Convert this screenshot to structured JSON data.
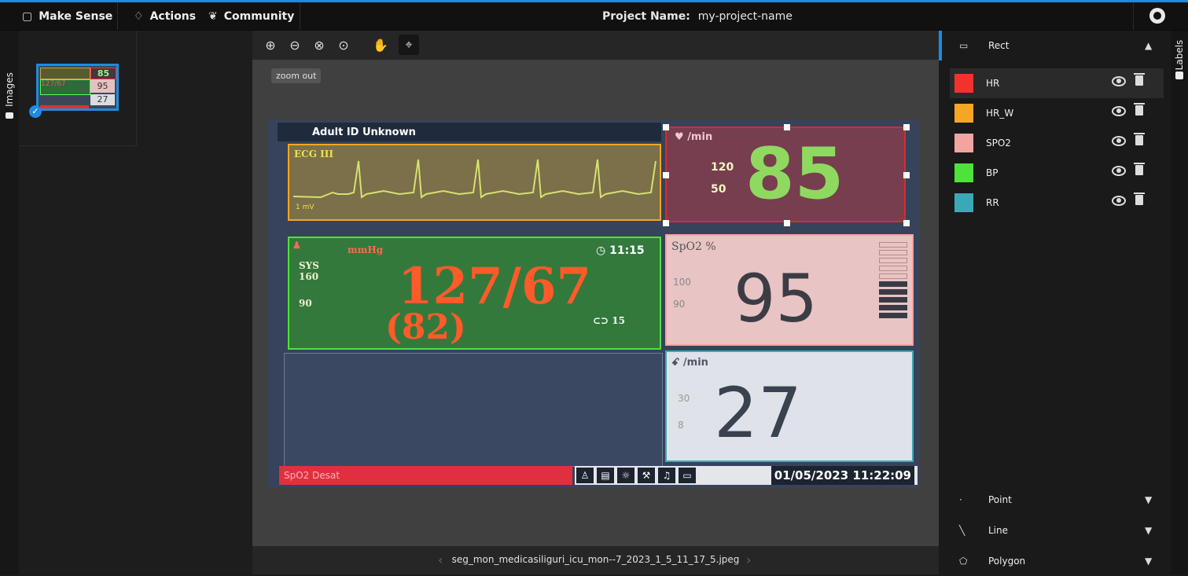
{
  "topbar": {
    "app_title": "Make Sense",
    "actions_label": "Actions",
    "community_label": "Community",
    "project_label": "Project Name:",
    "project_value": "my-project-name"
  },
  "left_sidebar": {
    "images_tab": "Images"
  },
  "right_sidebar": {
    "labels_tab": "Labels"
  },
  "editor": {
    "tooltip": "zoom out",
    "tools": [
      "zoom-in-icon",
      "zoom-out-icon",
      "zoom-fit-icon",
      "zoom-reset-icon",
      "hand-icon",
      "crosshair-icon"
    ],
    "active_tool": "crosshair-icon",
    "filename": "seg_mon_medicasiliguri_icu_mon--7_2023_1_5_11_17_5.jpeg",
    "prev_icon": "chevron-left-icon",
    "next_icon": "chevron-right-icon"
  },
  "monitor_image": {
    "header": "Adult  ID Unknown",
    "ecg_label": "ECG III",
    "ecg_scale": "1 mV",
    "hr_unit": "/min",
    "hr_upper": "120",
    "hr_lower": "50",
    "hr_value": "85",
    "bp_unit": "mmHg",
    "bp_sys_label": "SYS",
    "bp_upper": "160",
    "bp_lower": "90",
    "bp_time": "11:15",
    "bp_value": "127/67",
    "bp_mean": "(82)",
    "bp_cycle": "15",
    "spo2_label": "SpO2  %",
    "spo2_upper": "100",
    "spo2_lower": "90",
    "spo2_value": "95",
    "rr_unit": "/min",
    "rr_upper": "30",
    "rr_lower": "8",
    "rr_value": "27",
    "alarm": "SpO2 Desat",
    "datetime": "01/05/2023  11:22:09"
  },
  "thumbnail": {
    "hr": "85",
    "bp": "127/67",
    "spo2": "95",
    "rr": "27"
  },
  "rect_panel": {
    "title": "Rect",
    "labels": [
      {
        "name": "HR",
        "color": "#f5312d"
      },
      {
        "name": "HR_W",
        "color": "#f5a623"
      },
      {
        "name": "SPO2",
        "color": "#f4a4a0"
      },
      {
        "name": "BP",
        "color": "#4ee33a"
      },
      {
        "name": "RR",
        "color": "#3aa9b7"
      }
    ]
  },
  "other_tools": [
    {
      "name": "Point"
    },
    {
      "name": "Line"
    },
    {
      "name": "Polygon"
    }
  ]
}
